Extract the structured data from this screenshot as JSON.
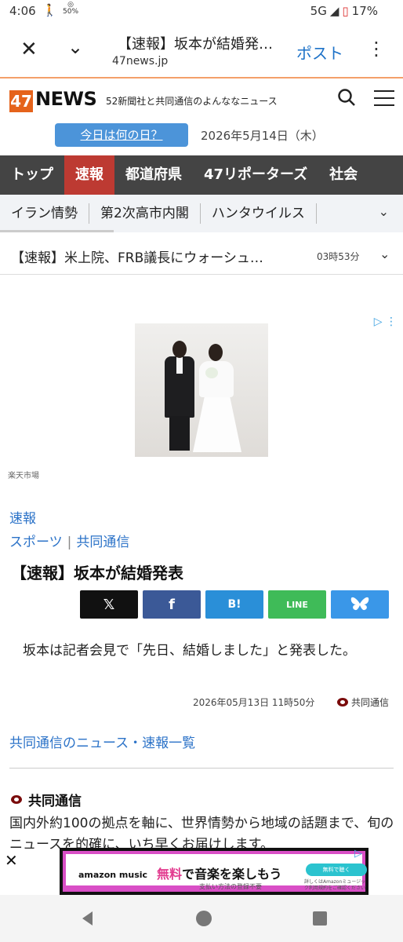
{
  "status_bar": {
    "time": "4:06",
    "dnd_label": "50%",
    "network": "5G",
    "battery": "17%"
  },
  "browser": {
    "page_title": "【速報】坂本が結婚発…",
    "url": "47news.jp",
    "post_label": "ポスト"
  },
  "site": {
    "logo_number": "47",
    "logo_text": "NEWS",
    "tagline": "52新聞社と共同通信のよんななニュース",
    "today_button": "今日は何の日？",
    "date": "2026年5月14日（木）"
  },
  "main_nav": [
    "トップ",
    "速報",
    "都道府県",
    "47リポーターズ",
    "社会"
  ],
  "sub_nav": [
    "イラン情勢",
    "第2次高市内閣",
    "ハンタウイルス"
  ],
  "breaking": {
    "text": "【速報】米上院、FRB議長にウォーシュ…",
    "time": "03時53分"
  },
  "ad": {
    "caption": "楽天市場"
  },
  "article": {
    "category": "速報",
    "tag_sports": "スポーツ",
    "tag_source": "共同通信",
    "title": "【速報】坂本が結婚発表",
    "body": "坂本は記者会見で「先日、結婚しました」と発表した。",
    "datetime": "2026年05月13日 11時50分",
    "source": "共同通信",
    "more_link": "共同通信のニュース・速報一覧"
  },
  "share": {
    "x": "𝕏",
    "facebook": "f",
    "hatena": "B!",
    "line": "LINE"
  },
  "kyodo": {
    "name": "共同通信",
    "description": "国内外約100の拠点を軸に、世界情勢から地域の話題まで、旬のニュースを的確に、いち早くお届けします。"
  },
  "bottom_ad": {
    "brand": "amazon music",
    "free": "無料",
    "message_rest": "で音楽を楽しもう",
    "sub": "支払い方法の登録不要",
    "button": "無料で聴く",
    "small": "詳しくはAmazonミュージック利用規約をご確認ください"
  }
}
